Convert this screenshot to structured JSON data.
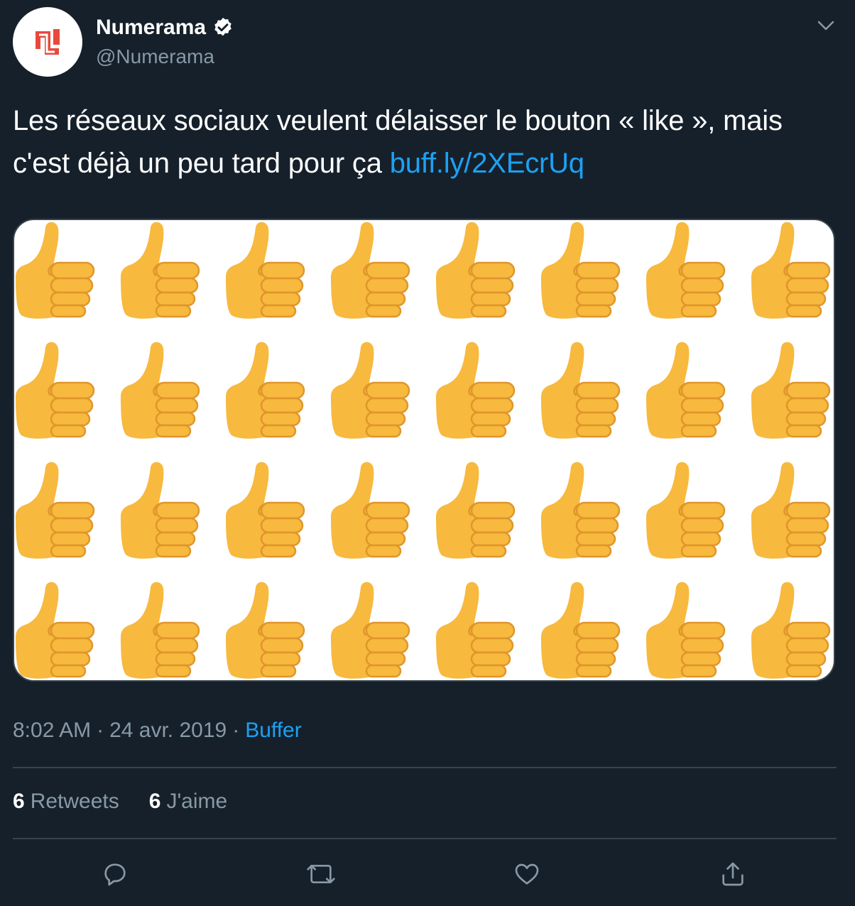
{
  "author": {
    "name": "Numerama",
    "handle": "@Numerama",
    "verified_icon": "verified-badge-icon",
    "avatar_icon": "numerama-logo-icon",
    "logo_color": "#e8493c"
  },
  "tweet": {
    "text": "Les réseaux sociaux veulent délaisser le bouton « like », mais c'est déjà un peu tard pour ça ",
    "link_text": "buff.ly/2XEcrUq"
  },
  "media": {
    "description_icon": "thumbs-up-emoji-grid",
    "emoji_color": "#f7b93e"
  },
  "meta": {
    "time": "8:02 AM",
    "separator": "·",
    "date": "24 avr. 2019",
    "source": "Buffer"
  },
  "stats": {
    "retweets_count": "6",
    "retweets_label": "Retweets",
    "likes_count": "6",
    "likes_label": "J'aime"
  },
  "actions": [
    "reply-icon",
    "retweet-icon",
    "like-icon",
    "share-icon"
  ],
  "colors": {
    "background": "#15202b",
    "secondary_text": "#8899a6",
    "link": "#1da1f2",
    "divider": "#38444d"
  }
}
